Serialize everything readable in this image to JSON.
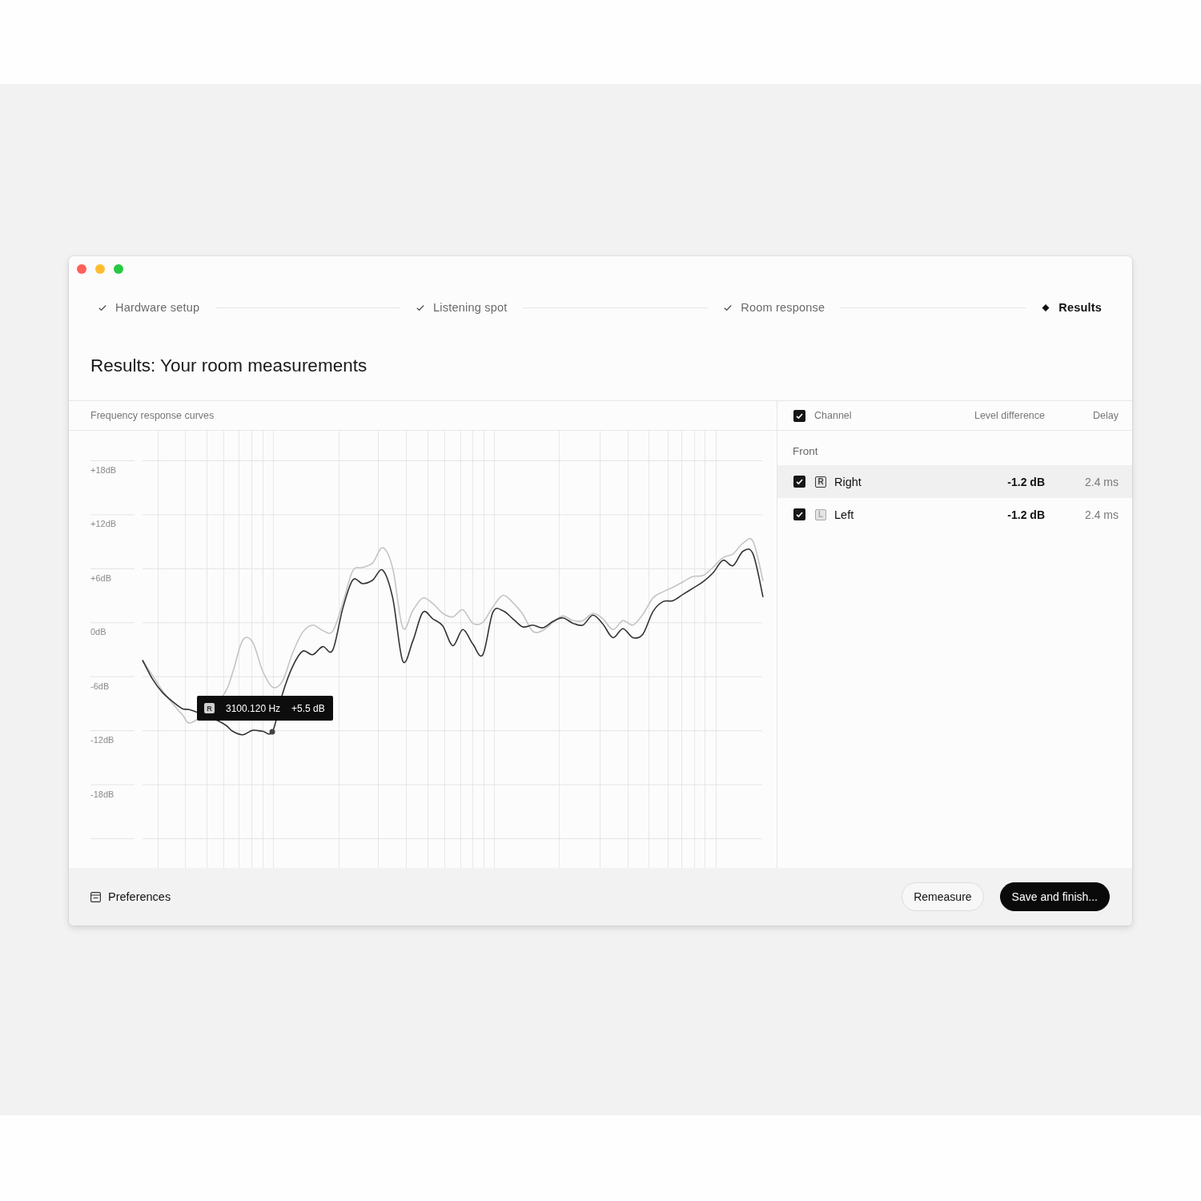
{
  "window": {
    "controls": [
      {
        "kind": "close"
      },
      {
        "kind": "minimize"
      },
      {
        "kind": "zoom"
      }
    ]
  },
  "steps": [
    {
      "label": "Hardware setup",
      "completed": true,
      "selected": false
    },
    {
      "label": "Listening spot",
      "completed": true,
      "selected": false
    },
    {
      "label": "Room response",
      "completed": true,
      "selected": false
    },
    {
      "label": "Results",
      "completed": false,
      "selected": true
    }
  ],
  "title": "Results: Your room measurements",
  "chart": {
    "chart_data": {
      "type": "line",
      "title": "Frequency response curves",
      "grid": true,
      "ylim": [
        -24,
        18
      ],
      "yticks": [
        {
          "value": 18,
          "label": "+18dB"
        },
        {
          "value": 12,
          "label": "+12dB"
        },
        {
          "value": 6,
          "label": "+6dB"
        },
        {
          "value": 0,
          "label": "0dB"
        },
        {
          "value": -6,
          "label": "-6dB"
        },
        {
          "value": -12,
          "label": "-12dB"
        },
        {
          "value": -18,
          "label": "-18dB"
        }
      ],
      "series": [
        {
          "color": "#333333",
          "values": [
            -4.2,
            -6.3,
            -7.8,
            -8.8,
            -9.6,
            -9.8,
            null,
            null,
            -11.2,
            -12.1,
            -12.5,
            -12.0,
            -12.1,
            -12.1,
            -7.9,
            -4.9,
            -3.2,
            -3.6,
            -2.7,
            -3.1,
            1.5,
            4.7,
            4.3,
            4.7,
            5.8,
            2.7,
            -4.3,
            -2.1,
            1.1,
            0.4,
            -0.4,
            -2.6,
            -0.8,
            -2.4,
            -3.6,
            1.1,
            1.3,
            0.4,
            -0.5,
            -0.3,
            -0.6,
            0.1,
            0.5,
            -0.1,
            -0.3,
            0.8,
            -0.2,
            -1.7,
            -0.7,
            -1.7,
            -1.3,
            1.2,
            2.3,
            2.4,
            3.1,
            3.8,
            4.5,
            5.5,
            6.9,
            6.3,
            7.9,
            7.6,
            2.8
          ]
        },
        {
          "color": "#c4c4c4",
          "values": [
            -4.2,
            -5.9,
            -7.6,
            -9.0,
            -10.3,
            -11.1,
            null,
            null,
            -8.2,
            -5.6,
            -2.0,
            -2.2,
            -5.4,
            -7.2,
            -6.5,
            -3.4,
            -1.1,
            -0.3,
            -0.9,
            -1.0,
            2.1,
            5.7,
            6.1,
            6.6,
            8.3,
            6.0,
            -0.6,
            1.3,
            2.7,
            2.1,
            1.0,
            0.6,
            1.4,
            -0.1,
            0.0,
            1.7,
            3.0,
            2.2,
            0.9,
            -1.0,
            -0.9,
            0.0,
            0.7,
            0.2,
            0.2,
            1.0,
            0.4,
            -0.8,
            0.2,
            -0.3,
            0.9,
            2.7,
            3.4,
            3.9,
            4.5,
            5.1,
            5.2,
            6.1,
            7.2,
            7.6,
            8.8,
            9.0,
            4.6
          ]
        }
      ]
    },
    "tooltip": {
      "badge": "R",
      "frequency": "3100.120 Hz",
      "reading": "+5.5 dB"
    }
  },
  "channels": {
    "select_all": {
      "checked": true
    },
    "columns": [
      "Channel",
      "Level difference",
      "Delay"
    ],
    "groups": [
      {
        "label": "Front",
        "rows": [
          {
            "badge": "R",
            "name": "Right",
            "color": "#3a3a3a",
            "level_difference": "-1.2 dB",
            "delay": "2.4 ms",
            "checked": true,
            "selected": true
          },
          {
            "badge": "L",
            "name": "Left",
            "color": "#a8a8a8",
            "level_difference": "-1.2 dB",
            "delay": "2.4 ms",
            "checked": true,
            "selected": false
          }
        ]
      }
    ]
  },
  "footer": {
    "link": "Preferences",
    "buttons": [
      {
        "label": "Remeasure",
        "kind": "secondary"
      },
      {
        "label": "Save and finish...",
        "kind": "primary"
      }
    ]
  }
}
